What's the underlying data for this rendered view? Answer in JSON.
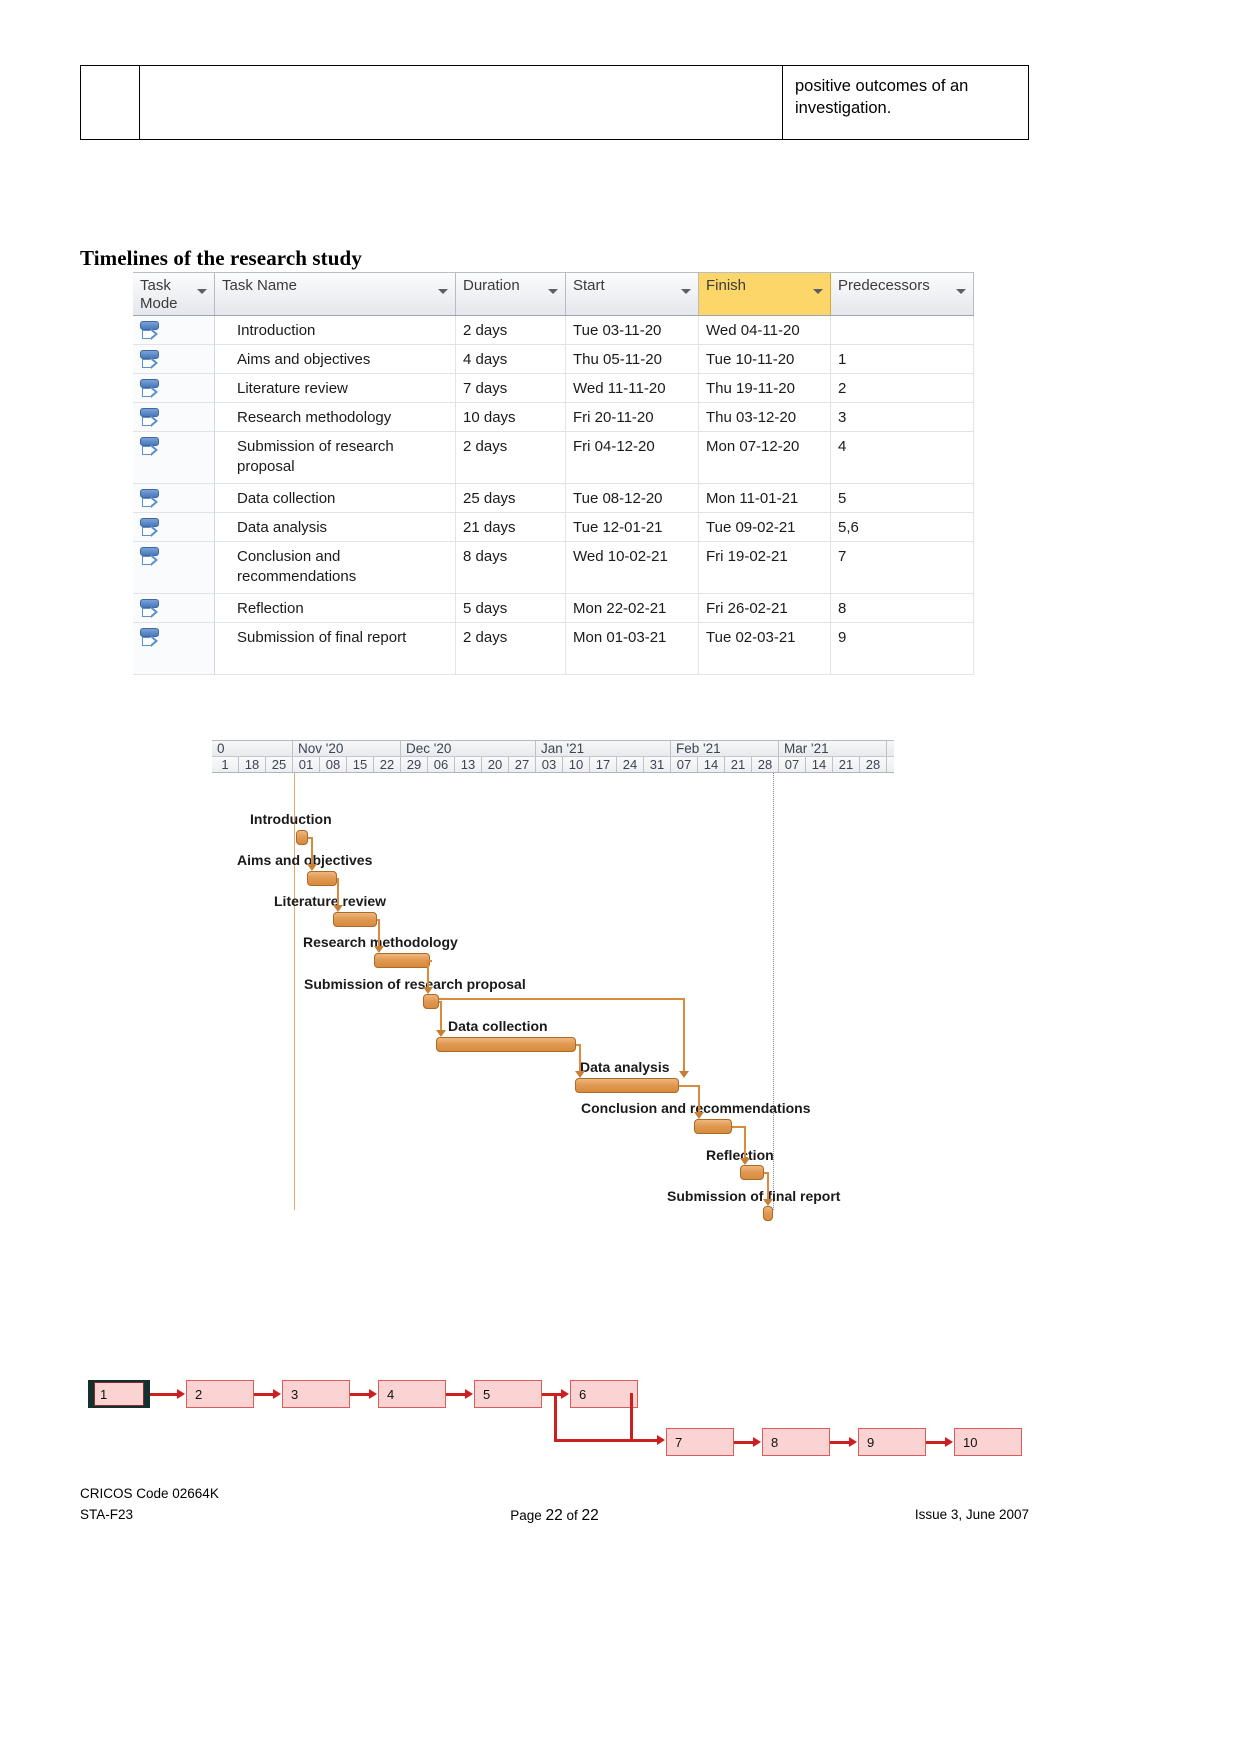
{
  "top_table": {
    "cell_text_line1": "positive outcomes of an",
    "cell_text_line2": "investigation."
  },
  "section": {
    "heading": "Timelines of the research study"
  },
  "project_grid": {
    "columns": [
      {
        "key": "task_mode",
        "label": "Task Mode",
        "highlighted": false
      },
      {
        "key": "task_name",
        "label": "Task Name",
        "highlighted": false
      },
      {
        "key": "duration",
        "label": "Duration",
        "highlighted": false
      },
      {
        "key": "start",
        "label": "Start",
        "highlighted": false
      },
      {
        "key": "finish",
        "label": "Finish",
        "highlighted": true
      },
      {
        "key": "predecessors",
        "label": "Predecessors",
        "highlighted": false
      }
    ],
    "highlight_color": "#fcd669",
    "rows": [
      {
        "id": 1,
        "mode_icon": "auto-schedule-icon",
        "name": "Introduction",
        "duration": "2 days",
        "start": "Tue 03-11-20",
        "finish": "Wed 04-11-20",
        "predecessors": ""
      },
      {
        "id": 2,
        "mode_icon": "auto-schedule-icon",
        "name": "Aims and objectives",
        "duration": "4 days",
        "start": "Thu 05-11-20",
        "finish": "Tue 10-11-20",
        "predecessors": "1"
      },
      {
        "id": 3,
        "mode_icon": "auto-schedule-icon",
        "name": "Literature review",
        "duration": "7 days",
        "start": "Wed 11-11-20",
        "finish": "Thu 19-11-20",
        "predecessors": "2"
      },
      {
        "id": 4,
        "mode_icon": "auto-schedule-icon",
        "name": "Research methodology",
        "duration": "10 days",
        "start": "Fri 20-11-20",
        "finish": "Thu 03-12-20",
        "predecessors": "3"
      },
      {
        "id": 5,
        "mode_icon": "auto-schedule-icon",
        "name": "Submission of research proposal",
        "duration": "2 days",
        "start": "Fri 04-12-20",
        "finish": "Mon 07-12-20",
        "predecessors": "4"
      },
      {
        "id": 6,
        "mode_icon": "auto-schedule-icon",
        "name": "Data collection",
        "duration": "25 days",
        "start": "Tue 08-12-20",
        "finish": "Mon 11-01-21",
        "predecessors": "5"
      },
      {
        "id": 7,
        "mode_icon": "auto-schedule-icon",
        "name": "Data analysis",
        "duration": "21 days",
        "start": "Tue 12-01-21",
        "finish": "Tue 09-02-21",
        "predecessors": "5,6"
      },
      {
        "id": 8,
        "mode_icon": "auto-schedule-icon",
        "name": "Conclusion and recommendations",
        "duration": "8 days",
        "start": "Wed 10-02-21",
        "finish": "Fri 19-02-21",
        "predecessors": "7"
      },
      {
        "id": 9,
        "mode_icon": "auto-schedule-icon",
        "name": "Reflection",
        "duration": "5 days",
        "start": "Mon 22-02-21",
        "finish": "Fri 26-02-21",
        "predecessors": "8"
      },
      {
        "id": 10,
        "mode_icon": "auto-schedule-icon",
        "name": "Submission of final report",
        "duration": "2 days",
        "start": "Mon 01-03-21",
        "finish": "Tue 02-03-21",
        "predecessors": "9"
      }
    ]
  },
  "gantt": {
    "months": [
      "0",
      "Nov '20",
      "Dec '20",
      "Jan '21",
      "Feb '21",
      "Mar '21"
    ],
    "weeks": [
      "1",
      "18",
      "25",
      "01",
      "08",
      "15",
      "22",
      "29",
      "06",
      "13",
      "20",
      "27",
      "03",
      "10",
      "17",
      "24",
      "31",
      "07",
      "14",
      "21",
      "28",
      "07",
      "14",
      "21",
      "28"
    ],
    "bar_color": "#e09a53",
    "bars": [
      {
        "label": "Introduction",
        "task_id": 1
      },
      {
        "label": "Aims and objectives",
        "task_id": 2
      },
      {
        "label": "Literature review",
        "task_id": 3
      },
      {
        "label": "Research methodology",
        "task_id": 4
      },
      {
        "label": "Submission of research proposal",
        "task_id": 5
      },
      {
        "label": "Data collection",
        "task_id": 6
      },
      {
        "label": "Data analysis",
        "task_id": 7
      },
      {
        "label": "Conclusion and recommendations",
        "task_id": 8
      },
      {
        "label": "Reflection",
        "task_id": 9
      },
      {
        "label": "Submission of final report",
        "task_id": 10
      }
    ]
  },
  "network": {
    "node_fill": "#fbd3d3",
    "node_border": "#e05a5a",
    "edge_color": "#cc1f1f",
    "nodes": [
      {
        "id": "1",
        "selected": true
      },
      {
        "id": "2",
        "selected": false
      },
      {
        "id": "3",
        "selected": false
      },
      {
        "id": "4",
        "selected": false
      },
      {
        "id": "5",
        "selected": false
      },
      {
        "id": "6",
        "selected": false
      },
      {
        "id": "7",
        "selected": false
      },
      {
        "id": "8",
        "selected": false
      },
      {
        "id": "9",
        "selected": false
      },
      {
        "id": "10",
        "selected": false
      }
    ]
  },
  "footer": {
    "cricos": "CRICOS Code 02664K",
    "form_code": "STA-F23",
    "page_label_prefix": "Page ",
    "page_number": "22",
    "page_of": " of ",
    "page_total": "22",
    "issue": "Issue 3, June 2007"
  }
}
